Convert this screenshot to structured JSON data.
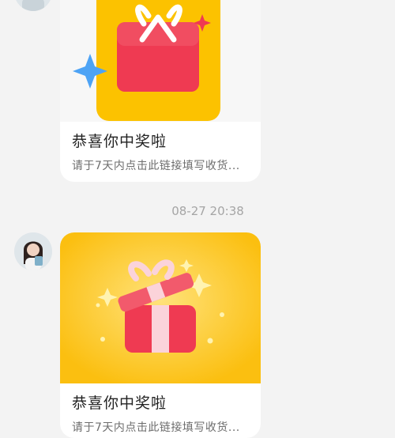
{
  "messages": [
    {
      "title": "恭喜你中奖啦",
      "description": "请于7天内点击此链接填写收货..."
    },
    {
      "title": "恭喜你中奖啦",
      "description": "请于7天内点击此链接填写收货..."
    }
  ],
  "timestamp": "08-27 20:38",
  "icons": {
    "avatar": "user-avatar",
    "gift_closed": "gift-box-icon",
    "gift_open": "open-gift-icon"
  },
  "colors": {
    "banner_yellow": "#fcc200",
    "gift_red": "#f0324a",
    "sparkle_blue": "#4da3f5",
    "background": "#f3f3f3"
  }
}
